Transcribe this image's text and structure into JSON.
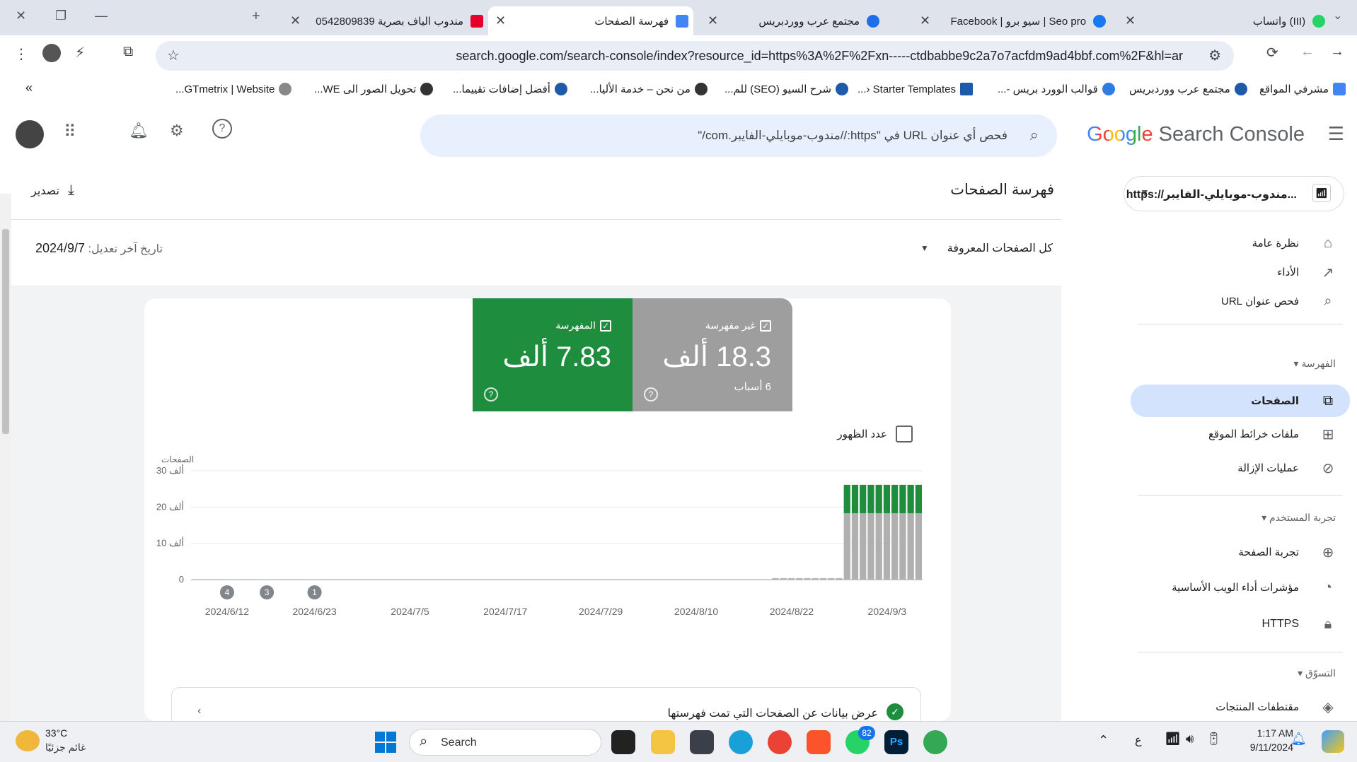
{
  "browser": {
    "tabs": [
      {
        "title": "(III) واتساب",
        "color": "#25d366",
        "active": false
      },
      {
        "title": "Seo pro | سيو برو | Facebook",
        "color": "#1877f2",
        "active": false
      },
      {
        "title": "مجتمع عرب ووردبريس",
        "color": "#1f6feb",
        "active": false
      },
      {
        "title": "فهرسة الصفحات",
        "color": "#4285f4",
        "active": true
      },
      {
        "title": "مندوب الياف بصرية 0542809839",
        "color": "#e4002b",
        "active": false
      }
    ],
    "new_tab": "+",
    "url": "search.google.com/search-console/index?resource_id=https%3A%2F%2Fxn-----ctdbabbe9c2a7o7acfdm9ad4bbf.com%2F&hl=ar",
    "bookmarks": [
      "مشرفي المواقع",
      "مجتمع عرب ووردبريس",
      "قوالب الوورد بريس -...",
      "Starter Templates ‹...",
      "شرح السيو (SEO) للم...",
      "من نحن – خدمة الأليا...",
      "أفضل إضافات تقييما...",
      "تحويل الصور الى WE...",
      "GTmetrix | Website..."
    ],
    "bookmarks_overflow": "»"
  },
  "app": {
    "logo_google": "Google",
    "logo_product": "Search Console",
    "search_placeholder": "فحص أي عنوان URL في \"https://مندوب-موبايلي-الفايبر.com/\"",
    "property_selector": "https://مندوب-موبايلي-الفايبر..."
  },
  "sidebar": {
    "items_top": [
      {
        "label": "نظرة عامة",
        "icon": "home-icon"
      },
      {
        "label": "الأداء",
        "icon": "trending-up-icon"
      },
      {
        "label": "فحص عنوان URL",
        "icon": "search-icon"
      }
    ],
    "section_indexing": "الفهرسة",
    "items_indexing": [
      {
        "label": "الصفحات",
        "icon": "pages-icon",
        "active": true
      },
      {
        "label": "ملفات خرائط الموقع",
        "icon": "sitemap-icon"
      },
      {
        "label": "عمليات الإزالة",
        "icon": "visibility-off-icon"
      }
    ],
    "section_experience": "تجربة المستخدم",
    "items_experience": [
      {
        "label": "تجربة الصفحة",
        "icon": "page-experience-icon"
      },
      {
        "label": "مؤشرات أداء الويب الأساسية",
        "icon": "speed-icon"
      },
      {
        "label": "HTTPS",
        "icon": "lock-icon"
      }
    ],
    "section_shopping": "التسوّق",
    "items_shopping": [
      {
        "label": "مقتطفات المنتجات",
        "icon": "layers-icon"
      }
    ]
  },
  "main": {
    "page_title": "فهرسة الصفحات",
    "export_label": "تصدير",
    "filter_label": "كل الصفحات المعروفة",
    "last_updated_label": "تاريخ آخر تعديل:",
    "last_updated_value": "2024/9/7",
    "not_indexed": {
      "label": "غير مفهرسة",
      "value": "18.3 ألف",
      "reasons": "6 أسباب"
    },
    "indexed": {
      "label": "المفهرسة",
      "value": "7.83 ألف"
    },
    "impressions_label": "عدد الظهور",
    "bottom_card_text": "عرض بيانات عن الصفحات التي تمت فهرستها"
  },
  "chart_data": {
    "type": "bar",
    "stacked": true,
    "ylabel": "الصفحات",
    "yticks": [
      "0",
      "10 ألف",
      "20 ألف",
      "30 ألف"
    ],
    "ylim": [
      0,
      30000
    ],
    "xticks": [
      "2024/6/12",
      "2024/6/23",
      "2024/7/5",
      "2024/7/17",
      "2024/7/29",
      "2024/8/10",
      "2024/8/22",
      "2024/9/3"
    ],
    "x_range": [
      "2024/6/8",
      "2024/9/7"
    ],
    "series": [
      {
        "name": "غير مفهرسة",
        "color": "#b0b0b0",
        "points": [
          [
            "2024/8/20",
            400
          ],
          [
            "2024/8/21",
            400
          ],
          [
            "2024/8/22",
            400
          ],
          [
            "2024/8/23",
            400
          ],
          [
            "2024/8/24",
            400
          ],
          [
            "2024/8/25",
            400
          ],
          [
            "2024/8/26",
            400
          ],
          [
            "2024/8/27",
            400
          ],
          [
            "2024/8/28",
            400
          ],
          [
            "2024/8/29",
            18300
          ],
          [
            "2024/8/30",
            18300
          ],
          [
            "2024/8/31",
            18300
          ],
          [
            "2024/9/1",
            18300
          ],
          [
            "2024/9/2",
            18300
          ],
          [
            "2024/9/3",
            18300
          ],
          [
            "2024/9/4",
            18300
          ],
          [
            "2024/9/5",
            18300
          ],
          [
            "2024/9/6",
            18300
          ],
          [
            "2024/9/7",
            18300
          ]
        ]
      },
      {
        "name": "المفهرسة",
        "color": "#1e8e3e",
        "points": [
          [
            "2024/8/29",
            7830
          ],
          [
            "2024/8/30",
            7830
          ],
          [
            "2024/8/31",
            7830
          ],
          [
            "2024/9/1",
            7830
          ],
          [
            "2024/9/2",
            7830
          ],
          [
            "2024/9/3",
            7830
          ],
          [
            "2024/9/4",
            7830
          ],
          [
            "2024/9/5",
            7830
          ],
          [
            "2024/9/6",
            7830
          ],
          [
            "2024/9/7",
            7830
          ]
        ]
      }
    ],
    "annotations": [
      {
        "label": "4",
        "date": "2024/6/12"
      },
      {
        "label": "3",
        "date": "2024/6/17"
      },
      {
        "label": "1",
        "date": "2024/6/23"
      }
    ]
  },
  "taskbar": {
    "weather_temp": "33°C",
    "weather_desc": "غائم جزئيًا",
    "search_label": "Search",
    "time": "1:17 AM",
    "date": "9/11/2024",
    "lang": "ع",
    "whatsapp_badge": "82"
  },
  "colors": {
    "indexed": "#1e8e3e",
    "not_indexed": "#9e9e9e",
    "active_nav": "#d3e3fd",
    "accent": "#1a73e8"
  }
}
